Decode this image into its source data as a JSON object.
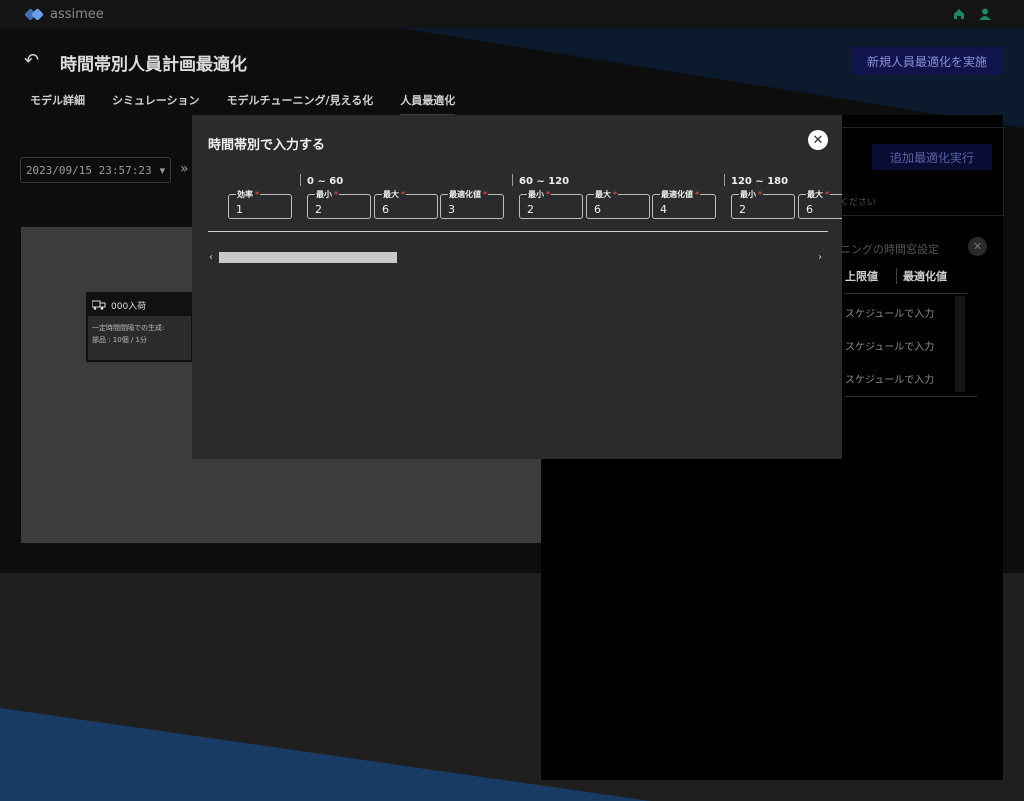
{
  "app": {
    "logo_text": "assimee",
    "icons": [
      "home-icon",
      "user-icon"
    ],
    "accent_color": "#1e5bbf"
  },
  "page": {
    "title": "時間帯別人員計画最適化",
    "primary_action": "新規人員最適化を実施",
    "tabs": [
      {
        "label": "モデル詳細",
        "active": false
      },
      {
        "label": "シミュレーション",
        "active": false
      },
      {
        "label": "モデルチューニング/見える化",
        "active": false
      },
      {
        "label": "人員最適化",
        "active": true
      }
    ]
  },
  "toolbar": {
    "date_value": "2023/09/15 23:57:23"
  },
  "flow": {
    "node1": {
      "title": "000入荷",
      "line1": "一定時間間隔での生成:",
      "line2": "部品 : 10個 / 1分"
    }
  },
  "right_panel": {
    "run_button": "追加最適化実行",
    "note": "ください",
    "tuning_label": "チューニングの時間窓設定",
    "headers": [
      "上限値",
      "最適化値"
    ],
    "rows": [
      {
        "text": "スケジュールで入力"
      },
      {
        "text": "スケジュールで入力"
      },
      {
        "text": "スケジュールで入力"
      }
    ]
  },
  "modal": {
    "title": "時間帯別で入力する",
    "efficiency": {
      "label": "効率",
      "value": "1"
    },
    "slots": [
      {
        "range": "0 ~ 60",
        "min_label": "最小",
        "min": "2",
        "max_label": "最大",
        "max": "6",
        "opt_label": "最適化値",
        "opt": "3"
      },
      {
        "range": "60 ~ 120",
        "min_label": "最小",
        "min": "2",
        "max_label": "最大",
        "max": "6",
        "opt_label": "最適化値",
        "opt": "4"
      },
      {
        "range": "120 ~ 180",
        "min_label": "最小",
        "min": "2",
        "max_label": "最大",
        "max": "6"
      }
    ]
  }
}
